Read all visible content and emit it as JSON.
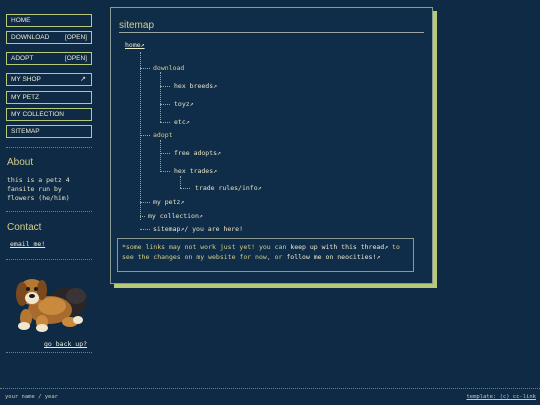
{
  "nav": {
    "home": "HOME",
    "download": "DOWNLOAD",
    "download_state": "[OPEN]",
    "adopt": "ADOPT",
    "adopt_state": "[OPEN]",
    "my_shop": "MY SHOP",
    "my_shop_arrow": "↗",
    "my_petz": "MY PETZ",
    "my_collection": "MY COLLECTION",
    "sitemap": "SITEMAP"
  },
  "about": {
    "heading": "About",
    "text": "this is a petz 4 fansite run by flowers (he/him)"
  },
  "contact": {
    "heading": "Contact",
    "email": "email me!"
  },
  "go_back": "go back up?",
  "sitemap": {
    "title": "sitemap",
    "home": "home↗",
    "download": "download",
    "hex_breeds": "hex breeds↗",
    "toyz": "toyz↗",
    "etc": "etc↗",
    "adopt": "adopt",
    "free_adopts": "free adopts↗",
    "hex_trades": "hex trades↗",
    "trade_rules": "trade rules/info↗",
    "my_petz": "my petz↗",
    "my_collection": "my collection↗",
    "sitemap_link": "sitemap↗",
    "you_are_here": "/ you are here!"
  },
  "note": {
    "a": "*some links may not work just yet! you can ",
    "b": "keep up with this thread",
    "c": "↗",
    "d": " to see the changes on my website for now, or ",
    "e": "follow me on neocities!",
    "f": "↗"
  },
  "footer": {
    "left": "your name / year",
    "right": "template: (c) cc-link"
  },
  "colors": {
    "background": "#0e2a45",
    "accent": "#b9c97a",
    "heading": "#d4cf8a"
  }
}
